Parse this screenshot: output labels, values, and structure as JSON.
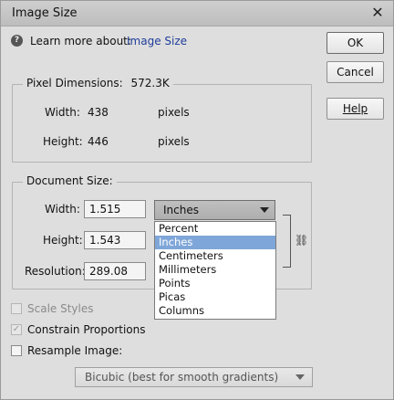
{
  "window": {
    "title": "Image Size",
    "close_label": "✕"
  },
  "learn_more": {
    "label": "Learn more about:",
    "link": "Image Size"
  },
  "buttons": {
    "ok": "OK",
    "cancel": "Cancel",
    "help": "Help"
  },
  "pixel_dimensions": {
    "title": "Pixel Dimensions:",
    "size": "572.3K",
    "width_label": "Width:",
    "width_value": "438",
    "width_unit": "pixels",
    "height_label": "Height:",
    "height_value": "446",
    "height_unit": "pixels"
  },
  "document_size": {
    "title": "Document Size:",
    "width_label": "Width:",
    "width_value": "1.515",
    "height_label": "Height:",
    "height_value": "1.543",
    "resolution_label": "Resolution:",
    "resolution_value": "289.08",
    "unit_selected": "Inches",
    "unit_options": [
      "Percent",
      "Inches",
      "Centimeters",
      "Millimeters",
      "Points",
      "Picas",
      "Columns"
    ]
  },
  "options": {
    "scale_styles": "Scale Styles",
    "constrain_proportions": "Constrain Proportions",
    "resample_image": "Resample Image:",
    "resample_method": "Bicubic (best for smooth gradients)"
  }
}
